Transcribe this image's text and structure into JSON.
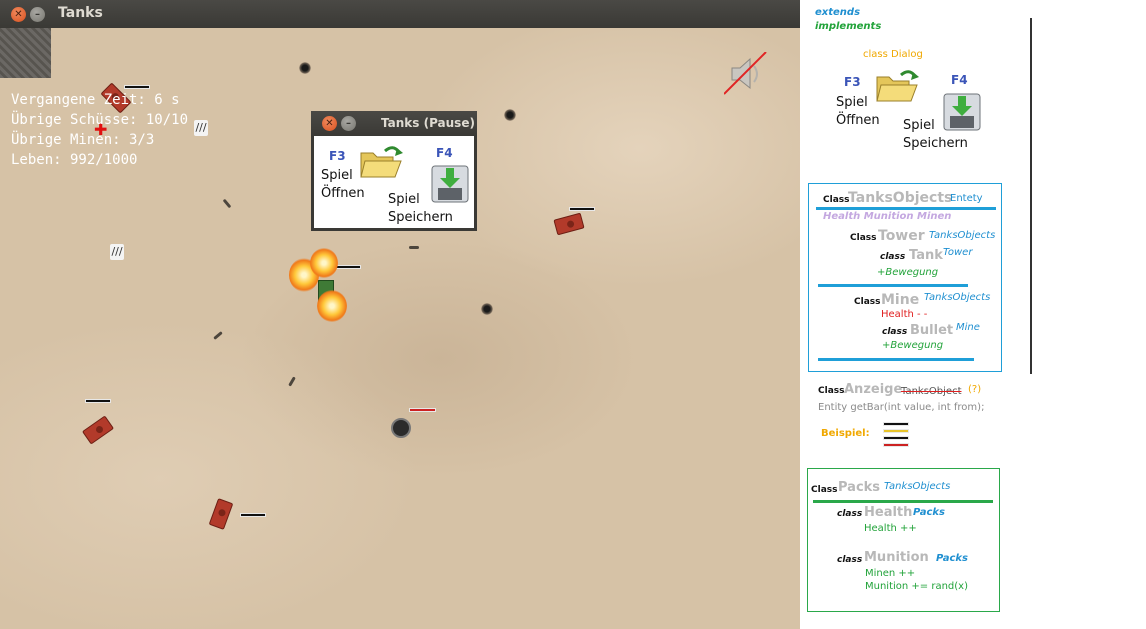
{
  "window": {
    "title": "Tanks"
  },
  "hud": {
    "elapsed": "Vergangene Zeit: 6 s",
    "shots": "Übrige Schüsse: 10/10",
    "mines": "Übrige Minen: 3/3",
    "life": "Leben: 992/1000"
  },
  "pause_dialog": {
    "title": "Tanks (Pause)",
    "open_key": "F3",
    "open_label_1": "Spiel",
    "open_label_2": "Öffnen",
    "save_key": "F4",
    "save_label_1": "Spiel",
    "save_label_2": "Speichern"
  },
  "diagram": {
    "legend": {
      "extends": "extends",
      "implements": "implements"
    },
    "dialog_class": {
      "title": "class Dialog",
      "open_key": "F3",
      "open_label_1": "Spiel",
      "open_label_2": "Öffnen",
      "save_key": "F4",
      "save_label_1": "Spiel",
      "save_label_2": "Speichern"
    },
    "tanks_objects": {
      "kw": "Class",
      "name": "TanksObjects",
      "parent": "Entety",
      "children": "Health Munition Minen",
      "tower": {
        "kw": "Class",
        "name": "Tower",
        "parent": "TanksObjects"
      },
      "tank": {
        "kw": "class",
        "name": "Tank",
        "parent": "Tower",
        "member": "+Bewegung"
      },
      "mine": {
        "kw": "Class",
        "name": "Mine",
        "parent": "TanksObjects",
        "member": "Health - -"
      },
      "bullet": {
        "kw": "class",
        "name": "Bullet",
        "parent": "Mine",
        "member": "+Bewegung"
      }
    },
    "anzeige": {
      "kw": "Class",
      "name": "Anzeige",
      "parent": "TanksObject",
      "note": "(?)",
      "method": "Entity getBar(int value, int from);",
      "example_label": "Beispiel:"
    },
    "packs": {
      "kw": "Class",
      "name": "Packs",
      "parent": "TanksObjects",
      "health": {
        "kw": "class",
        "name": "Health",
        "parent": "Packs",
        "member": "Health ++"
      },
      "munition": {
        "kw": "class",
        "name": "Munition",
        "parent": "Packs",
        "member1": "Minen ++",
        "member2": "Munition += rand(x)"
      }
    }
  },
  "colors": {
    "extends": "#1f8fd0",
    "implements": "#22a33a",
    "dialog_title": "#f0a800",
    "tanks_box": "#1f9fd8",
    "packs_box": "#2aa84a",
    "children": "#c4a8e0",
    "health_member": "#e02020",
    "example": "#f0a800"
  },
  "icons": [
    "close-icon",
    "minimize-icon",
    "muted-speaker-icon",
    "folder-open-icon",
    "floppy-disk-icon",
    "health-cross-icon",
    "mine-pack-icon"
  ]
}
